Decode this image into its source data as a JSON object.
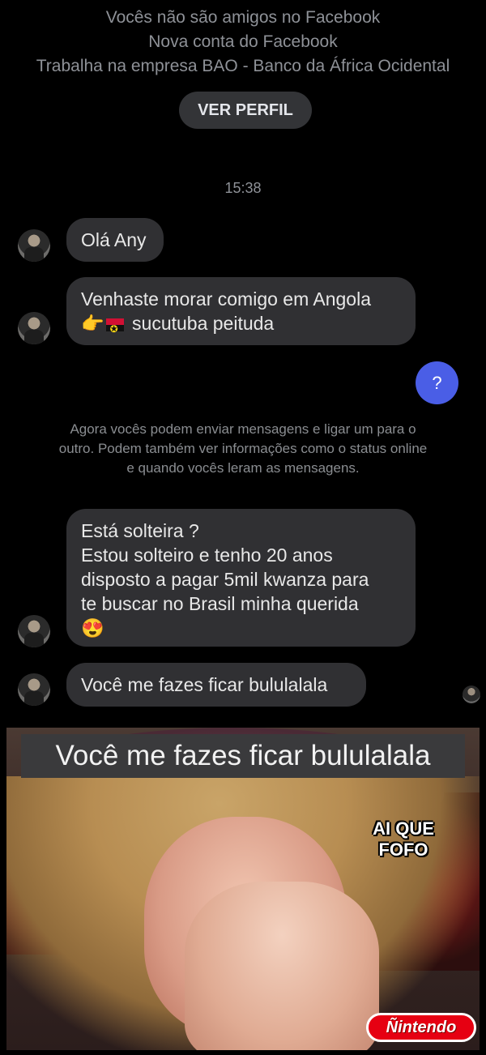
{
  "profile_header": {
    "lines": [
      "Vocês não são amigos no Facebook",
      "Nova conta do Facebook",
      "Trabalha na empresa BAO - Banco da África Ocidental"
    ],
    "view_profile_label": "VER PERFIL"
  },
  "timestamp": "15:38",
  "messages": [
    {
      "lines": [
        "Olá Any"
      ]
    },
    {
      "lines": [
        "Venhaste morar comigo em Angola",
        "sucutuba peituda"
      ],
      "emoji": "👉"
    },
    {
      "lines": [
        "Está solteira ?",
        "Estou solteiro e tenho 20 anos",
        "disposto a pagar 5mil kwanza para",
        "te buscar no Brasil minha querida",
        "😍"
      ]
    },
    {
      "lines": [
        "Você me fazes ficar bululalala"
      ]
    }
  ],
  "outgoing_message": "?",
  "system_note": "Agora vocês podem enviar mensagens e ligar um para o outro. Podem também ver informações como o status online e quando vocês leram as mensagens.",
  "meme": {
    "caption": "Você me fazes ficar bululalala",
    "overlay_text": "AI QUE FOFO",
    "logo_text": "Ñintendo"
  }
}
